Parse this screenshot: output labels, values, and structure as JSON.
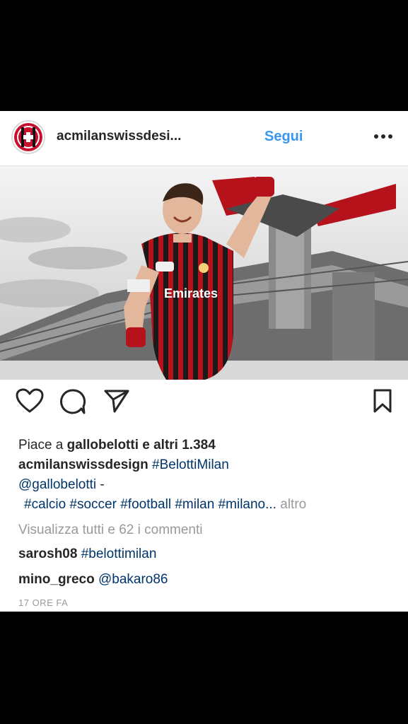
{
  "post": {
    "username": "acmilanswissdesi...",
    "follow_label": "Segui",
    "likes_prefix": "Piace a ",
    "likes_user": "gallobelotti",
    "likes_suffix": " e altri 1.384",
    "caption_user": "acmilanswissdesign",
    "caption_tag_main": "#BelottiMilan",
    "caption_mention": "@gallobelotti",
    "caption_dash": " -",
    "caption_hashtags": "#calcio #soccer #football #milan #milano...",
    "caption_more": "altro",
    "view_all_comments": "Visualizza tutti e 62 i commenti",
    "comments": [
      {
        "user": "sarosh08",
        "text": "#belottimilan"
      },
      {
        "user": "mino_greco",
        "text": "@bakaro86"
      }
    ],
    "timestamp": "17 ORE FA",
    "photo_alt_icon": "football-player-stadium-image"
  },
  "icons": {
    "avatar": "acmilan-swiss-logo-icon",
    "more": "more-options-icon",
    "like": "heart-icon",
    "comment": "comment-icon",
    "share": "share-icon",
    "save": "bookmark-icon"
  },
  "colors": {
    "link": "#003569",
    "follow": "#3897f0",
    "milan_red": "#c8102e",
    "text": "#262626",
    "muted": "#999999"
  }
}
